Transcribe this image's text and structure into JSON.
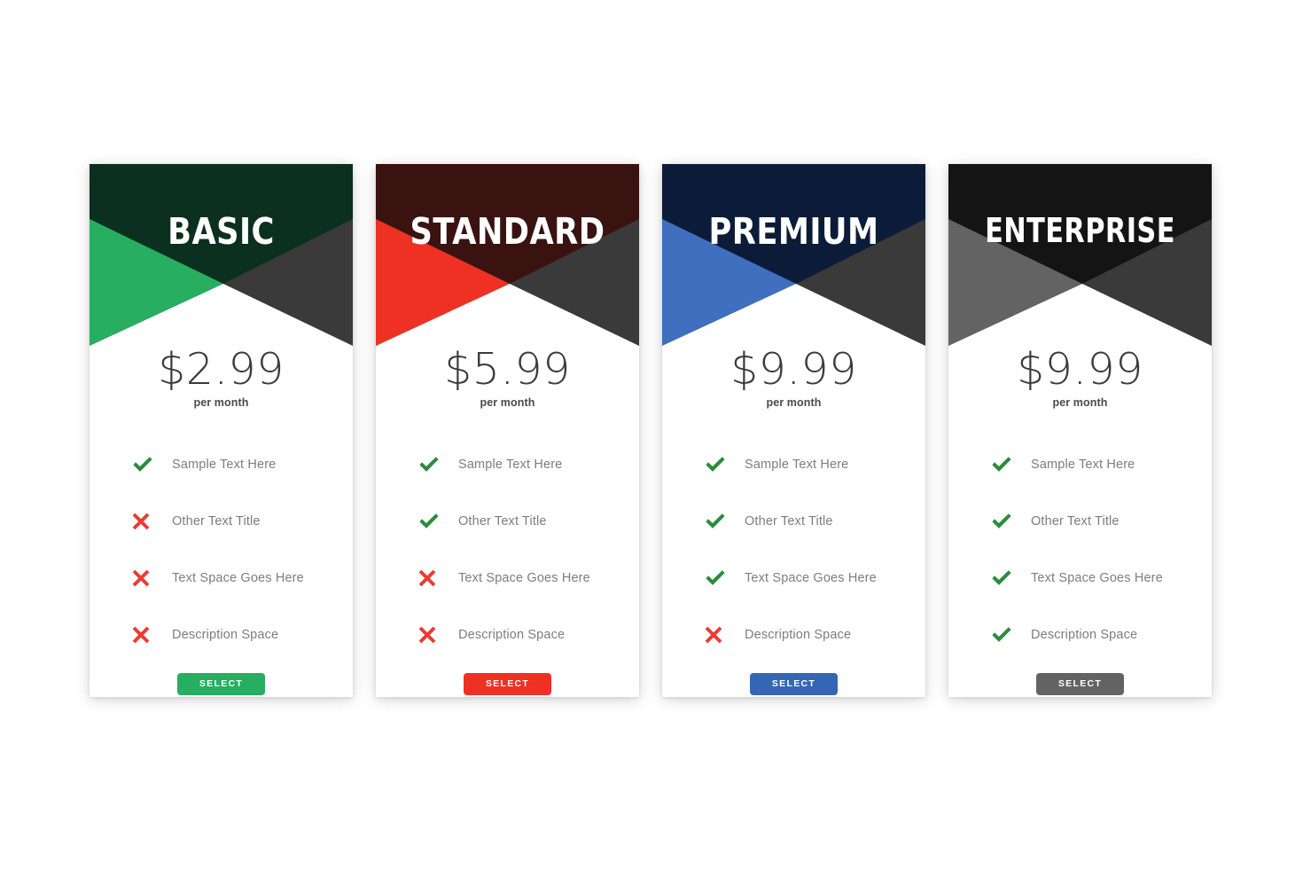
{
  "page": {
    "background": "#ffffff",
    "title": "Pricing Table"
  },
  "common": {
    "per_month_label": "per month",
    "select_label": "SELECT",
    "check_icon": "check-icon",
    "cross_icon": "cross-icon",
    "check_color": "#2e8b3d",
    "cross_color": "#ec3c31"
  },
  "plans": [
    {
      "id": "basic",
      "name": "BASIC",
      "price": "$2.99",
      "per_month": "per month",
      "select_label": "SELECT",
      "colors": {
        "header_dark": "#0c3020",
        "accent": "#27ae60",
        "wedge_gray": "#3a3a3a",
        "button": "#27ae60"
      },
      "features": [
        {
          "label": "Sample Text Here",
          "included": true
        },
        {
          "label": "Other Text Title",
          "included": false
        },
        {
          "label": "Text Space Goes Here",
          "included": false
        },
        {
          "label": "Description Space",
          "included": false
        }
      ]
    },
    {
      "id": "standard",
      "name": "STANDARD",
      "price": "$5.99",
      "per_month": "per month",
      "select_label": "SELECT",
      "colors": {
        "header_dark": "#3a1310",
        "accent": "#ef3124",
        "wedge_gray": "#3a3a3a",
        "button": "#ef3124"
      },
      "features": [
        {
          "label": "Sample Text Here",
          "included": true
        },
        {
          "label": "Other Text Title",
          "included": true
        },
        {
          "label": "Text Space Goes Here",
          "included": false
        },
        {
          "label": "Description Space",
          "included": false
        }
      ]
    },
    {
      "id": "premium",
      "name": "PREMIUM",
      "price": "$9.99",
      "per_month": "per month",
      "select_label": "SELECT",
      "colors": {
        "header_dark": "#0c1c38",
        "accent": "#3f6fbe",
        "wedge_gray": "#3a3a3a",
        "button": "#3566b5"
      },
      "features": [
        {
          "label": "Sample Text Here",
          "included": true
        },
        {
          "label": "Other Text Title",
          "included": true
        },
        {
          "label": "Text Space Goes Here",
          "included": true
        },
        {
          "label": "Description Space",
          "included": false
        }
      ]
    },
    {
      "id": "enterprise",
      "name": "ENTERPRISE",
      "price": "$9.99",
      "per_month": "per month",
      "select_label": "SELECT",
      "colors": {
        "header_dark": "#141414",
        "accent": "#636363",
        "wedge_gray": "#3a3a3a",
        "button": "#636363"
      },
      "features": [
        {
          "label": "Sample Text Here",
          "included": true
        },
        {
          "label": "Other Text Title",
          "included": true
        },
        {
          "label": "Text Space Goes Here",
          "included": true
        },
        {
          "label": "Description Space",
          "included": true
        }
      ]
    }
  ]
}
